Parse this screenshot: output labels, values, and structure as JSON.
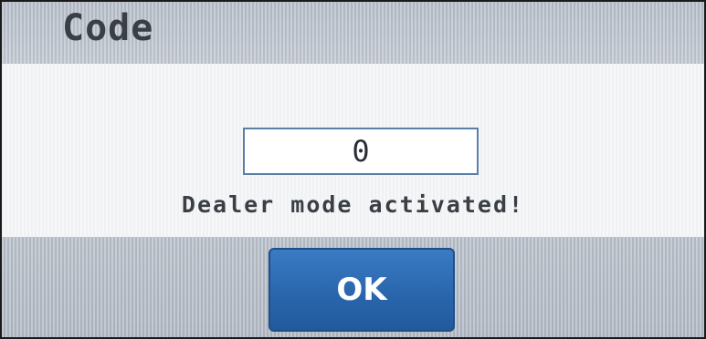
{
  "dialog": {
    "title": "Code",
    "code_value": "0",
    "message": "Dealer mode activated!",
    "ok_label": "OK"
  },
  "colors": {
    "button_blue": "#2a66ad",
    "field_border": "#5a7fa8",
    "text_dark": "#3a3f46"
  }
}
